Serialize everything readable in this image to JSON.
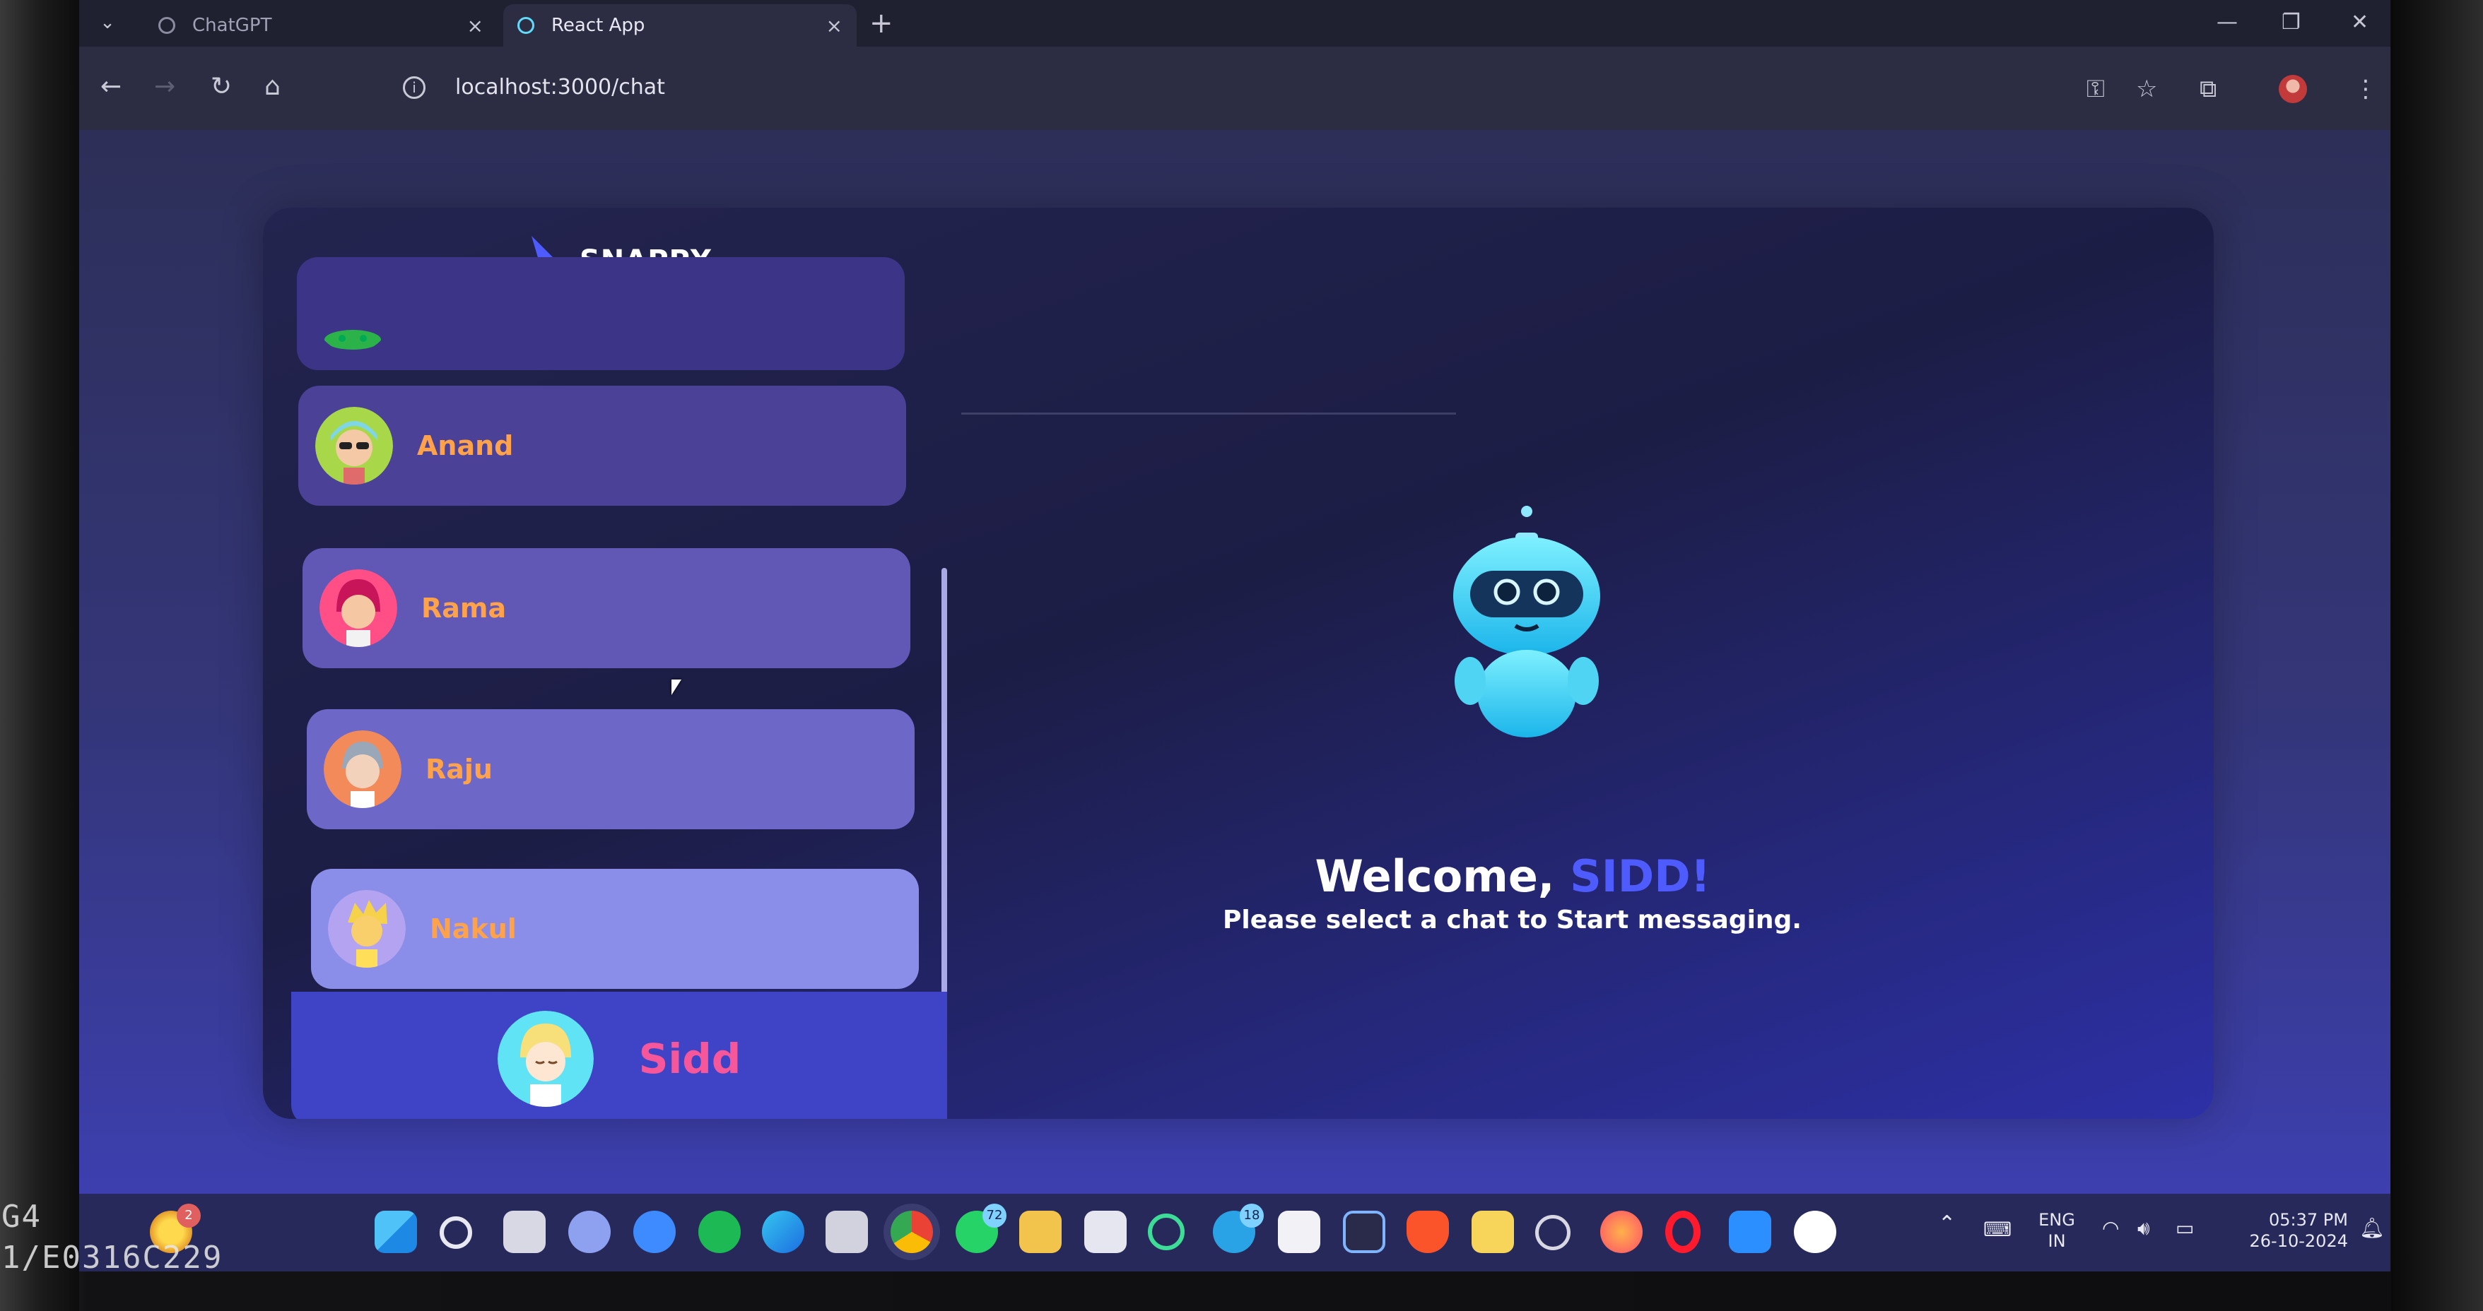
{
  "watermark": {
    "line1": "G4",
    "line2": "1/E0316C229"
  },
  "browser": {
    "tabs": [
      {
        "label": "ChatGPT",
        "active": false
      },
      {
        "label": "React App",
        "active": true
      }
    ],
    "new_tab_label": "+",
    "url": "localhost:3000/chat"
  },
  "app": {
    "brand": "SNAPPY",
    "contacts": [
      {
        "name": "Anand",
        "avatar": "avatar-blue-hair-glasses"
      },
      {
        "name": "Rama",
        "avatar": "avatar-pink-hair"
      },
      {
        "name": "Raju",
        "avatar": "avatar-grey-hair"
      },
      {
        "name": "Nakul",
        "avatar": "avatar-yellow-hair"
      }
    ],
    "current_user": {
      "name": "Sidd",
      "avatar": "avatar-blonde"
    },
    "welcome": {
      "prefix": "Welcome, ",
      "username": "SIDD!",
      "subtitle": "Please select a chat to Start messaging."
    },
    "colors": {
      "accent": "#4e5cff",
      "contact_name": "#ffa24a",
      "current_user_name": "#f6569a"
    }
  },
  "taskbar": {
    "notification_badge": "2",
    "whatsapp_badge": "72",
    "telegram_badge": "18",
    "language": {
      "line1": "ENG",
      "line2": "IN"
    },
    "time": "05:37 PM",
    "date": "26-10-2024",
    "apps": [
      "windows-start-icon",
      "search-icon",
      "task-view-icon",
      "chat-icon",
      "zoom-icon",
      "spotify-icon",
      "edge-icon",
      "store-icon",
      "chrome-icon",
      "whatsapp-icon",
      "file-explorer-icon",
      "notepad-icon",
      "refresh-app-icon",
      "telegram-icon",
      "powerpoint-icon",
      "intellij-icon",
      "brave-icon",
      "snipping-tool-icon",
      "sync-icon",
      "firefox-icon",
      "opera-icon",
      "vscode-icon",
      "ollama-icon"
    ]
  }
}
